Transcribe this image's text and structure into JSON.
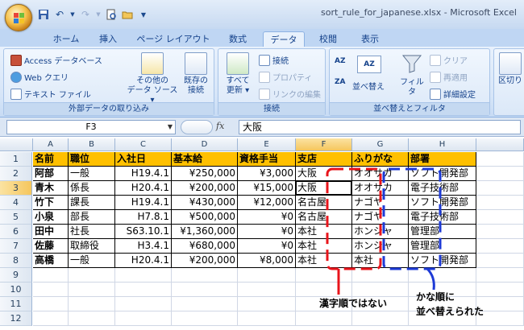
{
  "window": {
    "title": "sort_rule_for_japanese.xlsx - Microsoft Excel"
  },
  "quick_access": [
    "save-icon",
    "undo-icon",
    "redo-icon",
    "print-preview-icon",
    "open-icon"
  ],
  "tabs": [
    {
      "label": "ホーム",
      "active": false
    },
    {
      "label": "挿入",
      "active": false
    },
    {
      "label": "ページ レイアウト",
      "active": false
    },
    {
      "label": "数式",
      "active": false
    },
    {
      "label": "データ",
      "active": true
    },
    {
      "label": "校閲",
      "active": false
    },
    {
      "label": "表示",
      "active": false
    }
  ],
  "ribbon": {
    "external": {
      "label": "外部データの取り込み",
      "access": "Access データベース",
      "web": "Web クエリ",
      "text": "テキスト ファイル",
      "other_line1": "その他の",
      "other_line2": "データ ソース ▾",
      "existing_line1": "既存の",
      "existing_line2": "接続"
    },
    "connections": {
      "label": "接続",
      "refresh_line1": "すべて",
      "refresh_line2": "更新 ▾",
      "conn": "接続",
      "props": "プロパティ",
      "links": "リンクの編集"
    },
    "sort": {
      "label": "並べ替えとフィルタ",
      "az": "AZ",
      "za": "ZA",
      "sort": "並べ替え",
      "filter": "フィルタ",
      "clear": "クリア",
      "reapply": "再適用",
      "advanced": "詳細設定"
    },
    "tools": {
      "split": "区切り"
    }
  },
  "formula_bar": {
    "name_box": "F3",
    "fx": "fx",
    "content": "大阪"
  },
  "columns": [
    "A",
    "B",
    "C",
    "D",
    "E",
    "F",
    "G",
    "H"
  ],
  "rows": [
    "1",
    "2",
    "3",
    "4",
    "5",
    "6",
    "7",
    "8",
    "9",
    "10",
    "11",
    "12"
  ],
  "table": {
    "header": [
      "名前",
      "職位",
      "入社日",
      "基本給",
      "資格手当",
      "支店",
      "ふりがな",
      "部署"
    ],
    "rows": [
      [
        "阿部",
        "一般",
        "H19.4.1",
        "¥250,000",
        "¥3,000",
        "大阪",
        "オオサカ",
        "ソフト開発部"
      ],
      [
        "青木",
        "係長",
        "H20.4.1",
        "¥200,000",
        "¥15,000",
        "大阪",
        "オオサカ",
        "電子技術部"
      ],
      [
        "竹下",
        "課長",
        "H19.4.1",
        "¥430,000",
        "¥12,000",
        "名古屋",
        "ナゴヤ",
        "ソフト開発部"
      ],
      [
        "小泉",
        "部長",
        "H7.8.1",
        "¥500,000",
        "¥0",
        "名古屋",
        "ナゴヤ",
        "電子技術部"
      ],
      [
        "田中",
        "社長",
        "S63.10.1",
        "¥1,360,000",
        "¥0",
        "本社",
        "ホンシャ",
        "管理部"
      ],
      [
        "佐藤",
        "取締役",
        "H3.4.1",
        "¥680,000",
        "¥0",
        "本社",
        "ホンシャ",
        "管理部"
      ],
      [
        "高橋",
        "一般",
        "H20.4.1",
        "¥200,000",
        "¥8,000",
        "本社",
        "本社",
        "ソフト開発部"
      ]
    ]
  },
  "annotations": {
    "red": "漢字順ではない",
    "blue_line1": "かな順に",
    "blue_line2": "並べ替えられた",
    "red_color": "#e8141b",
    "blue_color": "#1d3ad6"
  }
}
